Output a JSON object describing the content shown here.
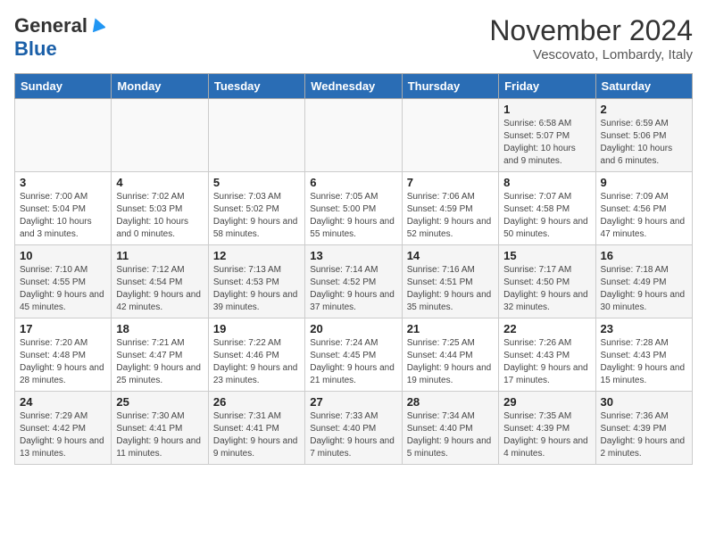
{
  "logo": {
    "general": "General",
    "blue": "Blue"
  },
  "title": "November 2024",
  "location": "Vescovato, Lombardy, Italy",
  "days_of_week": [
    "Sunday",
    "Monday",
    "Tuesday",
    "Wednesday",
    "Thursday",
    "Friday",
    "Saturday"
  ],
  "weeks": [
    [
      {
        "day": "",
        "info": ""
      },
      {
        "day": "",
        "info": ""
      },
      {
        "day": "",
        "info": ""
      },
      {
        "day": "",
        "info": ""
      },
      {
        "day": "",
        "info": ""
      },
      {
        "day": "1",
        "info": "Sunrise: 6:58 AM\nSunset: 5:07 PM\nDaylight: 10 hours and 9 minutes."
      },
      {
        "day": "2",
        "info": "Sunrise: 6:59 AM\nSunset: 5:06 PM\nDaylight: 10 hours and 6 minutes."
      }
    ],
    [
      {
        "day": "3",
        "info": "Sunrise: 7:00 AM\nSunset: 5:04 PM\nDaylight: 10 hours and 3 minutes."
      },
      {
        "day": "4",
        "info": "Sunrise: 7:02 AM\nSunset: 5:03 PM\nDaylight: 10 hours and 0 minutes."
      },
      {
        "day": "5",
        "info": "Sunrise: 7:03 AM\nSunset: 5:02 PM\nDaylight: 9 hours and 58 minutes."
      },
      {
        "day": "6",
        "info": "Sunrise: 7:05 AM\nSunset: 5:00 PM\nDaylight: 9 hours and 55 minutes."
      },
      {
        "day": "7",
        "info": "Sunrise: 7:06 AM\nSunset: 4:59 PM\nDaylight: 9 hours and 52 minutes."
      },
      {
        "day": "8",
        "info": "Sunrise: 7:07 AM\nSunset: 4:58 PM\nDaylight: 9 hours and 50 minutes."
      },
      {
        "day": "9",
        "info": "Sunrise: 7:09 AM\nSunset: 4:56 PM\nDaylight: 9 hours and 47 minutes."
      }
    ],
    [
      {
        "day": "10",
        "info": "Sunrise: 7:10 AM\nSunset: 4:55 PM\nDaylight: 9 hours and 45 minutes."
      },
      {
        "day": "11",
        "info": "Sunrise: 7:12 AM\nSunset: 4:54 PM\nDaylight: 9 hours and 42 minutes."
      },
      {
        "day": "12",
        "info": "Sunrise: 7:13 AM\nSunset: 4:53 PM\nDaylight: 9 hours and 39 minutes."
      },
      {
        "day": "13",
        "info": "Sunrise: 7:14 AM\nSunset: 4:52 PM\nDaylight: 9 hours and 37 minutes."
      },
      {
        "day": "14",
        "info": "Sunrise: 7:16 AM\nSunset: 4:51 PM\nDaylight: 9 hours and 35 minutes."
      },
      {
        "day": "15",
        "info": "Sunrise: 7:17 AM\nSunset: 4:50 PM\nDaylight: 9 hours and 32 minutes."
      },
      {
        "day": "16",
        "info": "Sunrise: 7:18 AM\nSunset: 4:49 PM\nDaylight: 9 hours and 30 minutes."
      }
    ],
    [
      {
        "day": "17",
        "info": "Sunrise: 7:20 AM\nSunset: 4:48 PM\nDaylight: 9 hours and 28 minutes."
      },
      {
        "day": "18",
        "info": "Sunrise: 7:21 AM\nSunset: 4:47 PM\nDaylight: 9 hours and 25 minutes."
      },
      {
        "day": "19",
        "info": "Sunrise: 7:22 AM\nSunset: 4:46 PM\nDaylight: 9 hours and 23 minutes."
      },
      {
        "day": "20",
        "info": "Sunrise: 7:24 AM\nSunset: 4:45 PM\nDaylight: 9 hours and 21 minutes."
      },
      {
        "day": "21",
        "info": "Sunrise: 7:25 AM\nSunset: 4:44 PM\nDaylight: 9 hours and 19 minutes."
      },
      {
        "day": "22",
        "info": "Sunrise: 7:26 AM\nSunset: 4:43 PM\nDaylight: 9 hours and 17 minutes."
      },
      {
        "day": "23",
        "info": "Sunrise: 7:28 AM\nSunset: 4:43 PM\nDaylight: 9 hours and 15 minutes."
      }
    ],
    [
      {
        "day": "24",
        "info": "Sunrise: 7:29 AM\nSunset: 4:42 PM\nDaylight: 9 hours and 13 minutes."
      },
      {
        "day": "25",
        "info": "Sunrise: 7:30 AM\nSunset: 4:41 PM\nDaylight: 9 hours and 11 minutes."
      },
      {
        "day": "26",
        "info": "Sunrise: 7:31 AM\nSunset: 4:41 PM\nDaylight: 9 hours and 9 minutes."
      },
      {
        "day": "27",
        "info": "Sunrise: 7:33 AM\nSunset: 4:40 PM\nDaylight: 9 hours and 7 minutes."
      },
      {
        "day": "28",
        "info": "Sunrise: 7:34 AM\nSunset: 4:40 PM\nDaylight: 9 hours and 5 minutes."
      },
      {
        "day": "29",
        "info": "Sunrise: 7:35 AM\nSunset: 4:39 PM\nDaylight: 9 hours and 4 minutes."
      },
      {
        "day": "30",
        "info": "Sunrise: 7:36 AM\nSunset: 4:39 PM\nDaylight: 9 hours and 2 minutes."
      }
    ]
  ]
}
